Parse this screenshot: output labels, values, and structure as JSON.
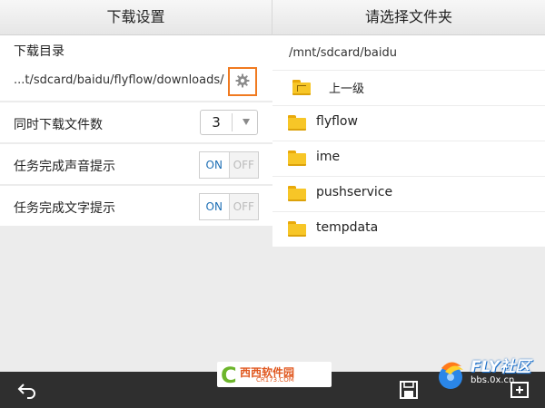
{
  "left_panel": {
    "title": "下载设置",
    "download_dir": {
      "label": "下载目录",
      "path": "...t/sdcard/baidu/flyflow/downloads/",
      "button_icon": "gear-icon"
    },
    "concurrent_downloads": {
      "label": "同时下载文件数",
      "value": "3"
    },
    "sound_alert": {
      "label": "任务完成声音提示",
      "on_label": "ON",
      "off_label": "OFF",
      "state": "on"
    },
    "text_alert": {
      "label": "任务完成文字提示",
      "on_label": "ON",
      "off_label": "OFF",
      "state": "on"
    }
  },
  "right_panel": {
    "title": "请选择文件夹",
    "current_path": "/mnt/sdcard/baidu",
    "up_label": "上一级",
    "folders": [
      "flyflow",
      "ime",
      "pushservice",
      "tempdata"
    ]
  },
  "bottom_bar": {
    "icons": [
      "back-icon",
      "save-icon",
      "new-folder-icon"
    ]
  },
  "watermarks": {
    "cnxz_text": "西西软件园",
    "cnxz_url": "CR173.COM",
    "fly_text": "FLY社区",
    "fly_url": "bbs.0x.cn"
  },
  "colors": {
    "accent_orange": "#f07a20",
    "toggle_on_blue": "#1d6fb5",
    "folder_yellow": "#f7c627"
  }
}
